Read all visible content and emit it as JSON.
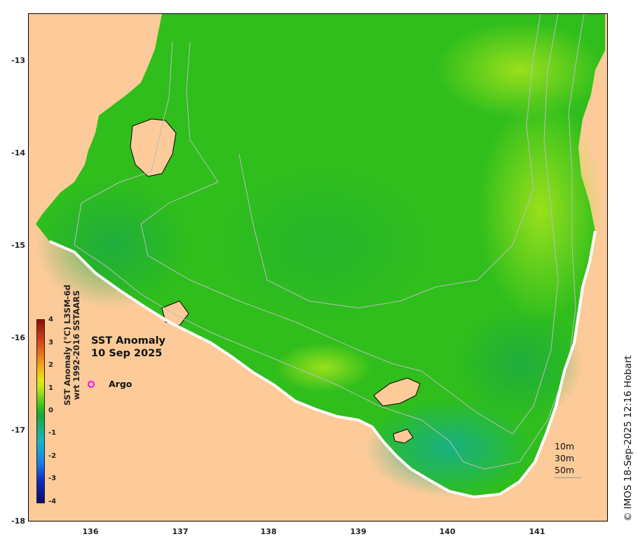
{
  "map": {
    "title_line1": "SST Anomaly",
    "title_line2": "10 Sep 2025",
    "y_ticks": [
      "-13",
      "-14",
      "-15",
      "-16",
      "-17",
      "-18"
    ],
    "x_ticks": [
      "136",
      "137",
      "138",
      "139",
      "140",
      "141"
    ],
    "land_color": "#fccb99",
    "sea_color": "#2fbe1c",
    "argo_color": "#ff00ff"
  },
  "legend": {
    "argo_label": "Argo",
    "depth_contours": [
      "10m",
      "30m",
      "50m"
    ]
  },
  "colorbar": {
    "ticks": [
      "4",
      "3",
      "2",
      "1",
      "0",
      "-1",
      "-2",
      "-3",
      "-4"
    ],
    "label_line1": "SST Anomaly (°C) L3SM-6d",
    "label_line2": "wrt 1992-2016 SSTAARS",
    "range": [
      -4,
      4
    ]
  },
  "credit": "© IMOS 18-Sep-2025 12:16 Hobart"
}
